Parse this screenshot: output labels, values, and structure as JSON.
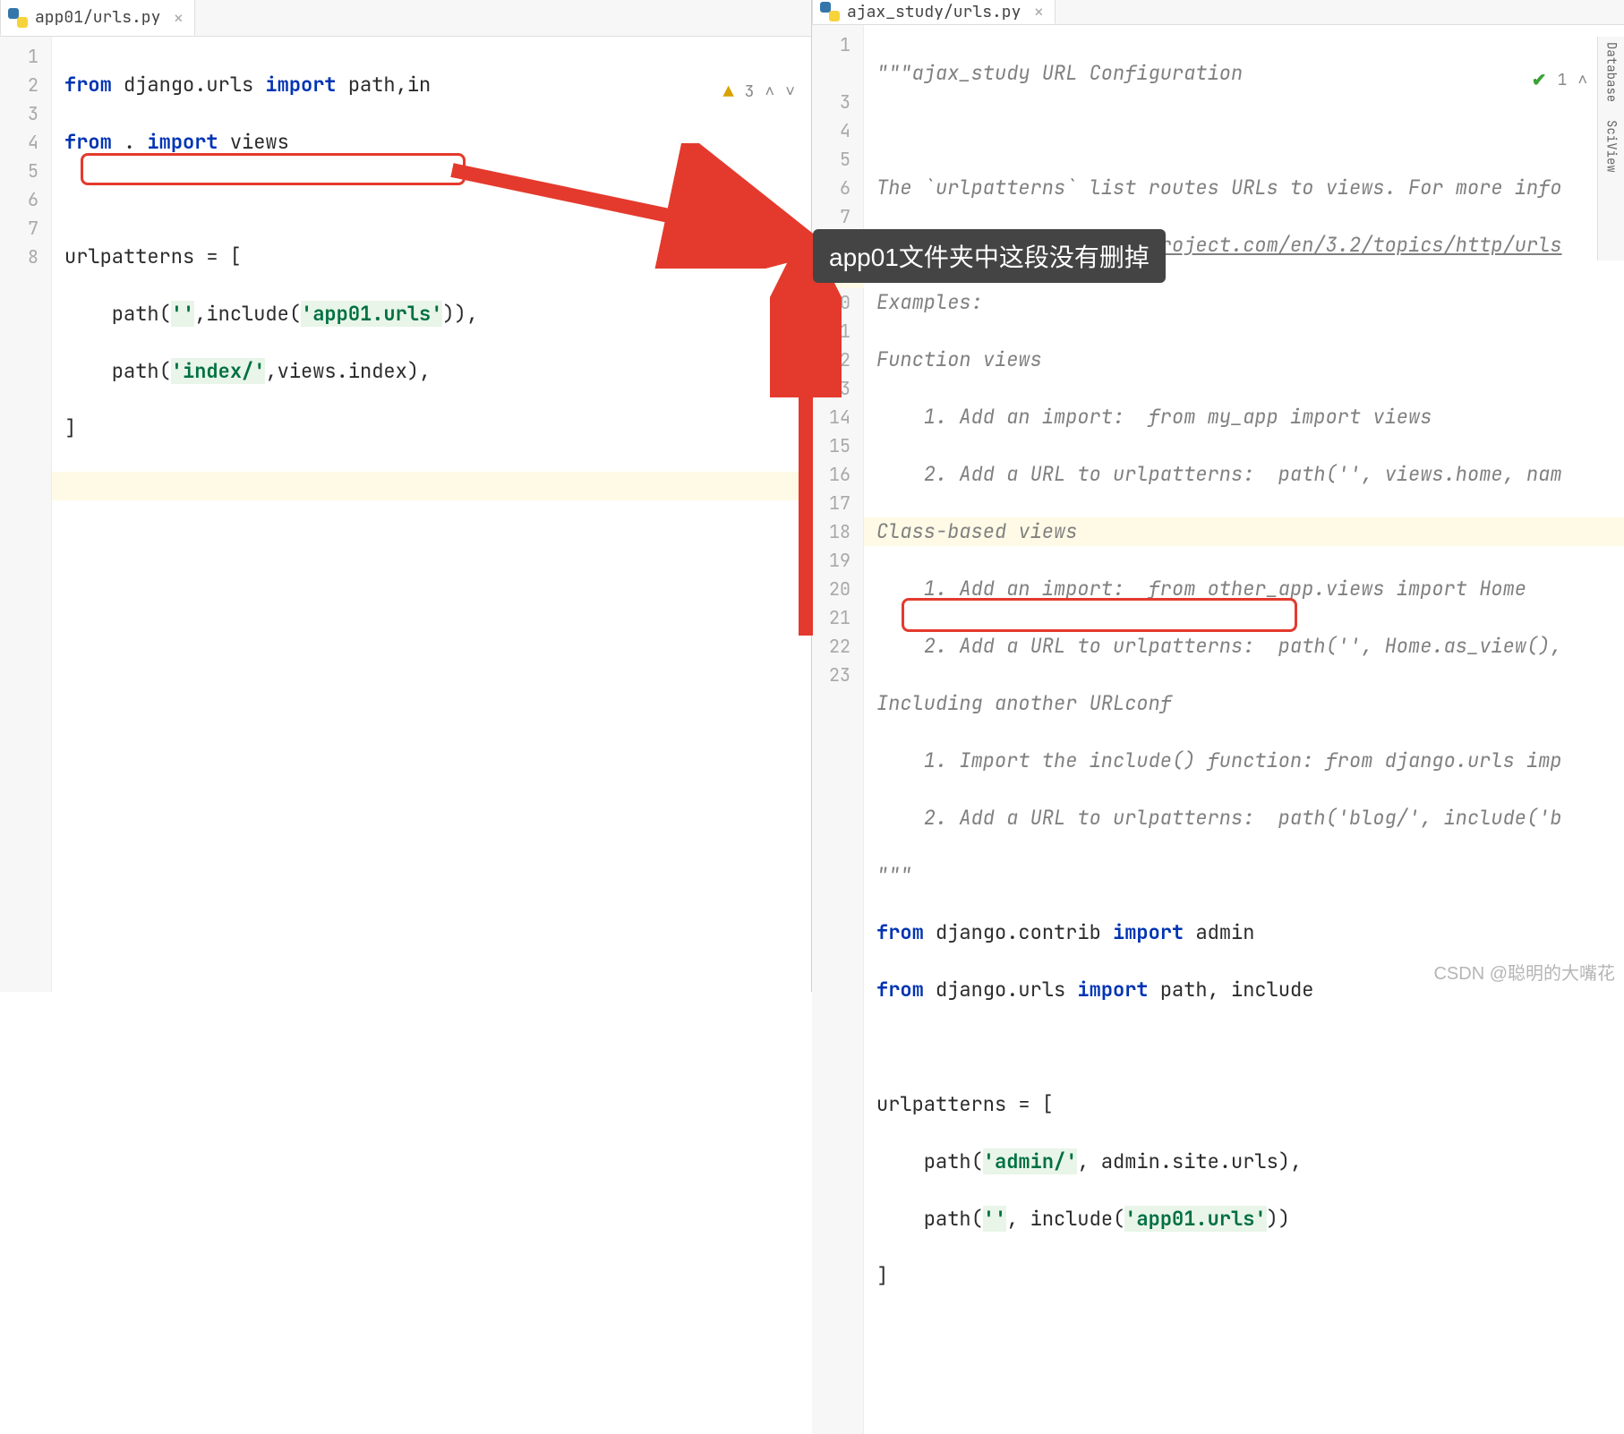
{
  "tabs": {
    "left": "app01/urls.py",
    "right": "ajax_study/urls.py"
  },
  "inspections": {
    "left_warn_count": "3",
    "right_ok_count": "1"
  },
  "left_code": {
    "l1_a": "from",
    "l1_b": "django.urls",
    "l1_c": "import",
    "l1_d": "path,in",
    "l2_a": "from",
    "l2_b": ".",
    "l2_c": "import",
    "l2_d": "views",
    "l4": "urlpatterns = [",
    "l5_a": "    path(",
    "l5_b": "''",
    "l5_c": ",include(",
    "l5_d": "'app01.urls'",
    "l5_e": ")),",
    "l6_a": "    path(",
    "l6_b": "'index/'",
    "l6_c": ",views.index),",
    "l7": "]"
  },
  "right_code": {
    "l1": "\"\"\"ajax_study URL Configuration",
    "l3": "The `urlpatterns` list routes URLs to views. For more info",
    "l4": "    https://docs.djangoproject.com/en/3.2/topics/http/urls",
    "l5": "Examples:",
    "l6": "Function views",
    "l7": "    1. Add an import:  from my_app import views",
    "l8": "    2. Add a URL to urlpatterns:  path('', views.home, nam",
    "l9": "Class-based views",
    "l10": "    1. Add an import:  from other_app.views import Home",
    "l11": "    2. Add a URL to urlpatterns:  path('', Home.as_view(),",
    "l12": "Including another URLconf",
    "l13": "    1. Import the include() function: from django.urls imp",
    "l14": "    2. Add a URL to urlpatterns:  path('blog/', include('b",
    "l15": "\"\"\"",
    "l16_a": "from",
    "l16_b": "django.contrib",
    "l16_c": "import",
    "l16_d": "admin",
    "l17_a": "from",
    "l17_b": "django.urls",
    "l17_c": "import",
    "l17_d": "path, include",
    "l19": "urlpatterns = [",
    "l20_a": "    path(",
    "l20_b": "'admin/'",
    "l20_c": ", admin.site.urls),",
    "l21_a": "    path(",
    "l21_b": "''",
    "l21_c": ", include(",
    "l21_d": "'app01.urls'",
    "l21_e": "))",
    "l22": "]"
  },
  "tooltip": "app01文件夹中这段没有删掉",
  "right_panel": {
    "db": "Database",
    "sv": "SciView"
  },
  "watermark": "CSDN @聪明的大嘴花"
}
